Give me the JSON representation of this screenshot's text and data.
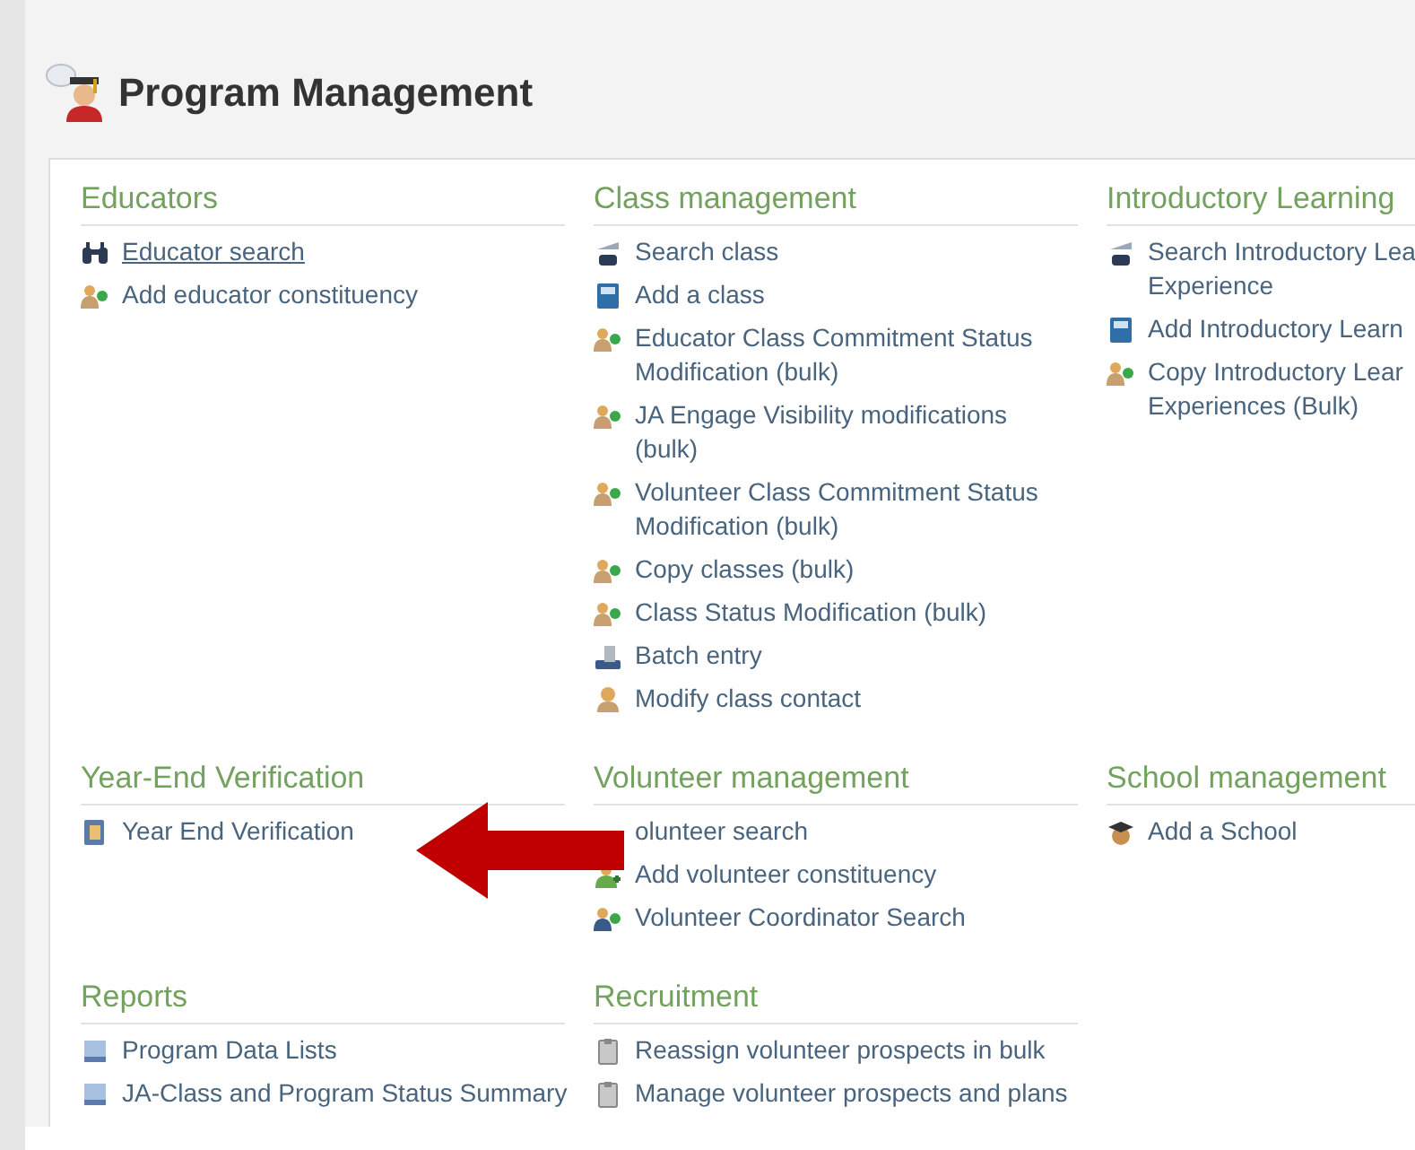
{
  "page": {
    "title": "Program Management"
  },
  "sections": [
    {
      "title": "Educators",
      "items": [
        {
          "kind": "binoculars",
          "lines": [
            "Educator search"
          ],
          "underlined": true
        },
        {
          "kind": "people",
          "lines": [
            "Add educator constituency"
          ],
          "underlined": false
        }
      ]
    },
    {
      "title": "Class management",
      "items": [
        {
          "kind": "search",
          "lines": [
            "Search class"
          ],
          "underlined": false
        },
        {
          "kind": "book",
          "lines": [
            "Add a class"
          ],
          "underlined": false
        },
        {
          "kind": "people",
          "lines": [
            "Educator Class Commitment Status",
            "Modification (bulk)"
          ],
          "underlined": false
        },
        {
          "kind": "people",
          "lines": [
            "JA Engage Visibility modifications",
            "(bulk)"
          ],
          "underlined": false
        },
        {
          "kind": "people",
          "lines": [
            "Volunteer Class Commitment Status",
            "Modification (bulk)"
          ],
          "underlined": false
        },
        {
          "kind": "people",
          "lines": [
            "Copy classes (bulk)"
          ],
          "underlined": false
        },
        {
          "kind": "people",
          "lines": [
            "Class Status Modification (bulk)"
          ],
          "underlined": false
        },
        {
          "kind": "batch",
          "lines": [
            "Batch entry"
          ],
          "underlined": false
        },
        {
          "kind": "contact",
          "lines": [
            "Modify class contact"
          ],
          "underlined": false
        }
      ]
    },
    {
      "title": "Introductory Learning",
      "items": [
        {
          "kind": "search",
          "lines": [
            "Search Introductory Lea",
            "Experience"
          ],
          "underlined": false
        },
        {
          "kind": "book",
          "lines": [
            "Add Introductory Learn"
          ],
          "underlined": false
        },
        {
          "kind": "people",
          "lines": [
            "Copy Introductory Lear",
            "Experiences (Bulk)"
          ],
          "underlined": false
        }
      ]
    },
    {
      "title": "Year-End Verification",
      "items": [
        {
          "kind": "verification",
          "lines": [
            "Year End Verification"
          ],
          "underlined": false
        }
      ]
    },
    {
      "title": "Volunteer management",
      "items": [
        {
          "kind": "hidden",
          "lines": [
            "olunteer search"
          ],
          "underlined": false
        },
        {
          "kind": "volunteer",
          "lines": [
            "Add volunteer constituency"
          ],
          "underlined": false
        },
        {
          "kind": "coordinator",
          "lines": [
            "Volunteer Coordinator Search"
          ],
          "underlined": false
        }
      ]
    },
    {
      "title": "School management",
      "items": [
        {
          "kind": "school",
          "lines": [
            "Add a School"
          ],
          "underlined": false
        }
      ]
    },
    {
      "title": "Reports",
      "items": [
        {
          "kind": "report",
          "lines": [
            "Program Data Lists"
          ],
          "underlined": false
        },
        {
          "kind": "report",
          "lines": [
            "JA-Class and Program Status Summary"
          ],
          "underlined": false
        }
      ]
    },
    {
      "title": "Recruitment",
      "items": [
        {
          "kind": "clipboard",
          "lines": [
            "Reassign volunteer prospects in bulk"
          ],
          "underlined": false
        },
        {
          "kind": "clipboard",
          "lines": [
            "Manage volunteer prospects and plans"
          ],
          "underlined": false
        }
      ]
    }
  ]
}
